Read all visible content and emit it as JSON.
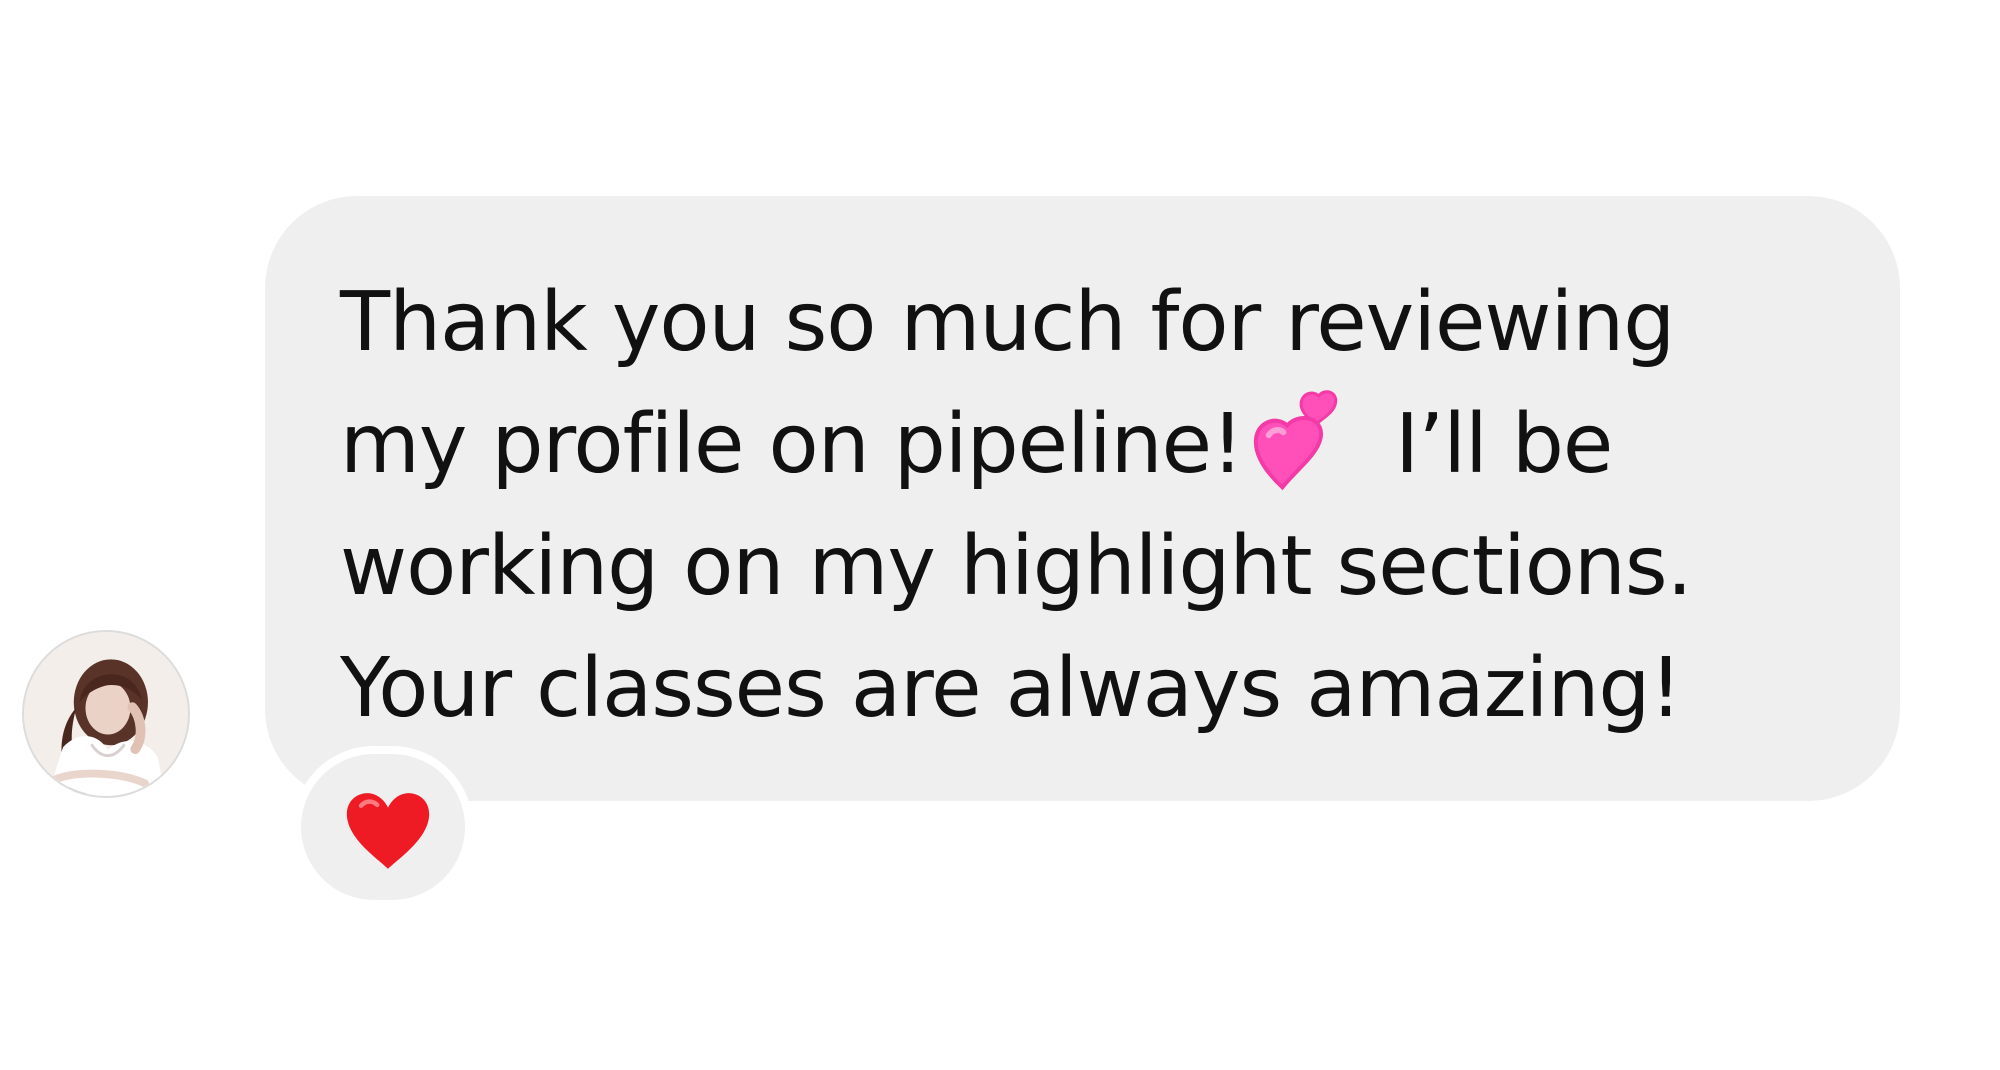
{
  "message": {
    "lines": [
      "Thank you so much for reviewing",
      "my profile on pipeline!",
      "I’ll be",
      "working on my highlight sections.",
      "Your classes are always amazing!"
    ]
  },
  "avatar": {
    "icon": "user-avatar-icon"
  },
  "reaction": {
    "emoji": "red-heart-icon"
  },
  "colors": {
    "bubble_bg": "#efefef",
    "text": "#111111",
    "reaction_heart": "#ef1b24",
    "pink_hearts": "#ff4fb8"
  }
}
